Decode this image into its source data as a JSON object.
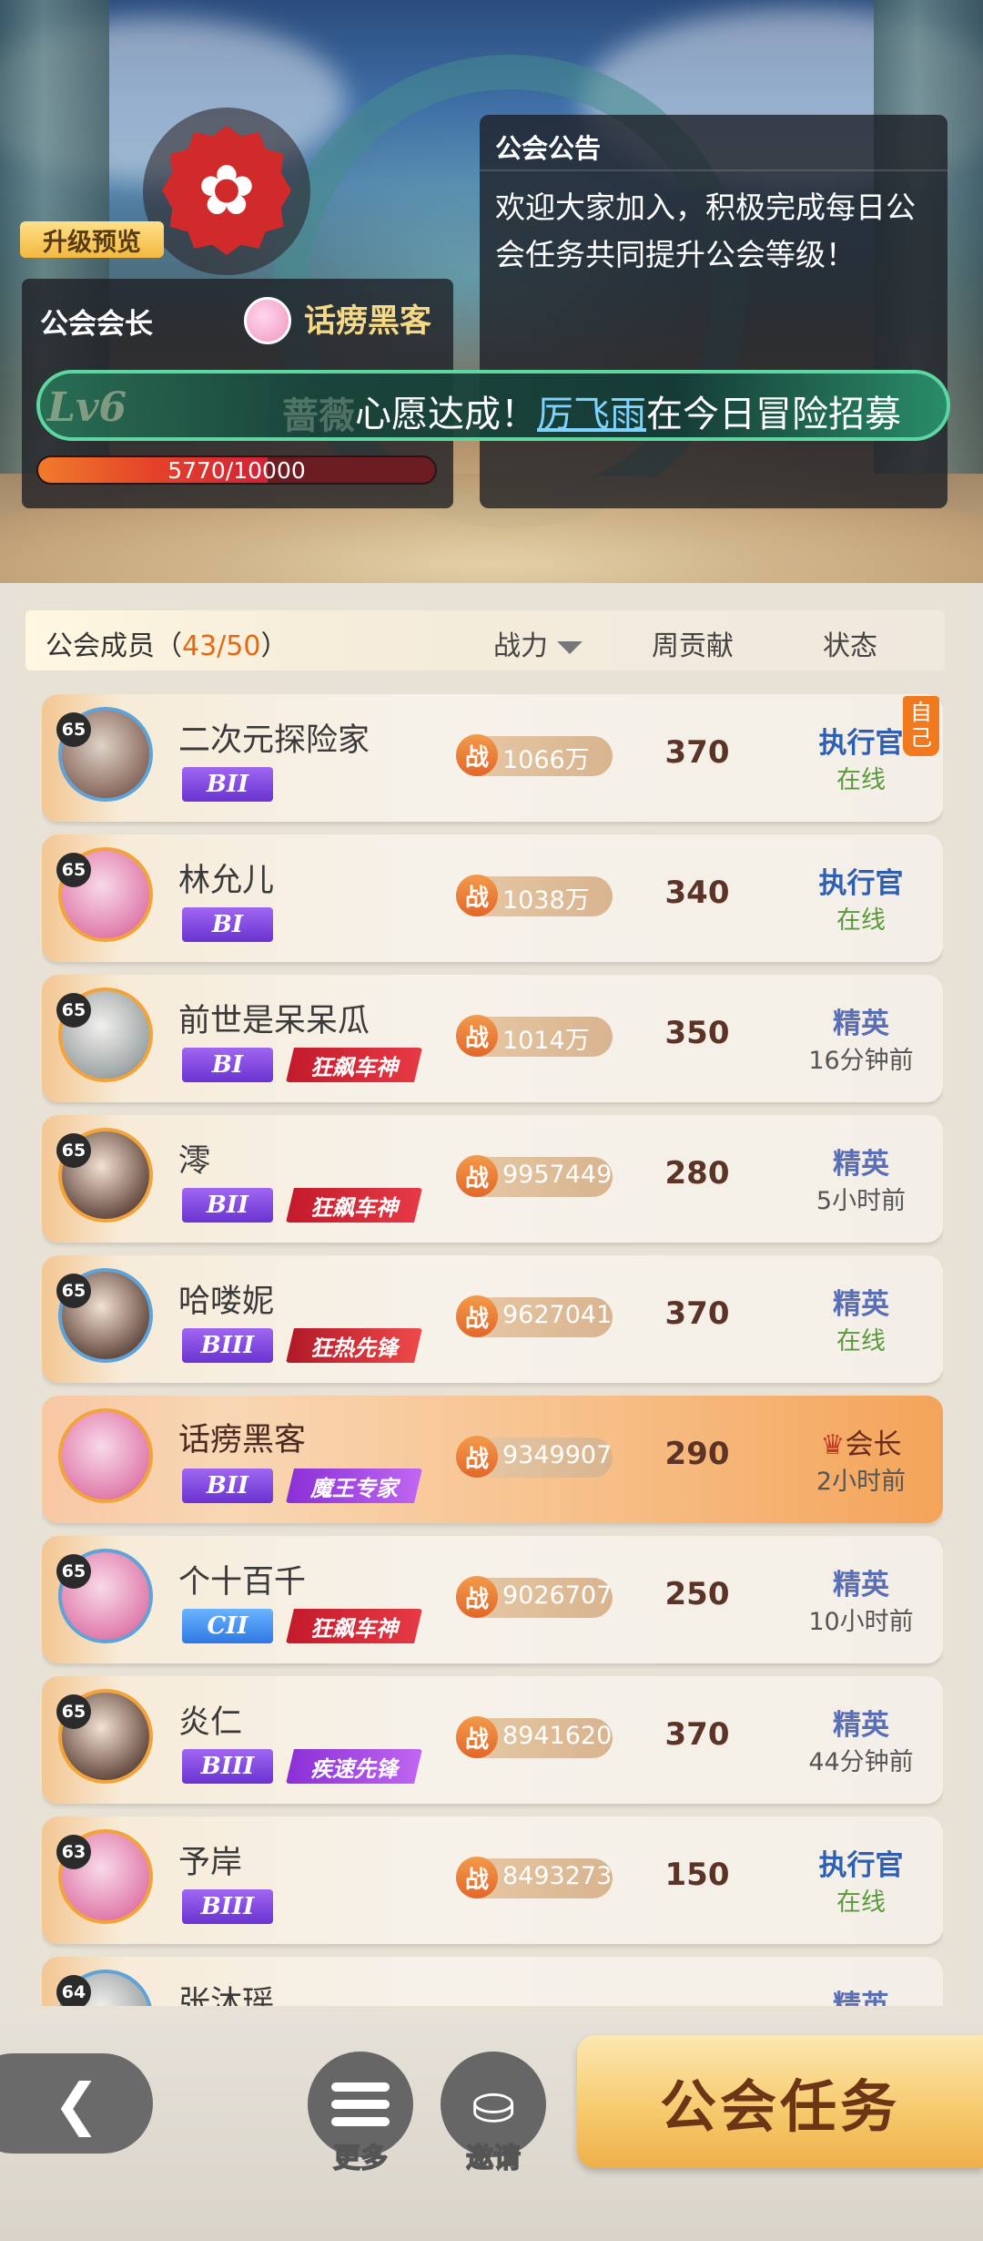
{
  "header": {
    "upgrade_preview": "升级预览",
    "leader_label": "公会会长",
    "leader_name": "话痨黑客",
    "notice_title": "公会公告",
    "notice_text": "欢迎大家加入，积极完成每日公会任务共同提升公会等级！",
    "level": "Lv6",
    "guild_name": "蔷薇",
    "ticker_prefix": "心愿达成！",
    "ticker_name": "厉飞雨",
    "ticker_suffix": "在今日冒险招募",
    "exp_text": "5770/10000",
    "exp_fraction": 0.577
  },
  "list_header": {
    "members_label": "公会成员",
    "members_paren_open": "（",
    "members_count": "43/50",
    "members_paren_close": "）",
    "power_label": "战力",
    "weekly_label": "周贡献",
    "status_label": "状态"
  },
  "members": [
    {
      "level": "65",
      "name": "二次元探险家",
      "rank": "BII",
      "title": "",
      "power": "1066万",
      "weekly": "370",
      "role": "执行官",
      "status": "在线",
      "self_tag": "自己"
    },
    {
      "level": "65",
      "name": "林允儿",
      "rank": "BI",
      "title": "",
      "power": "1038万",
      "weekly": "340",
      "role": "执行官",
      "status": "在线"
    },
    {
      "level": "65",
      "name": "前世是呆呆瓜",
      "rank": "BI",
      "title": "狂飙车神",
      "power": "1014万",
      "weekly": "350",
      "role": "精英",
      "status": "16分钟前"
    },
    {
      "level": "65",
      "name": "澪",
      "rank": "BII",
      "title": "狂飙车神",
      "power": "9957449",
      "weekly": "280",
      "role": "精英",
      "status": "5小时前"
    },
    {
      "level": "65",
      "name": "哈喽妮",
      "rank": "BIII",
      "title": "狂热先锋",
      "power": "9627041",
      "weekly": "370",
      "role": "精英",
      "status": "在线"
    },
    {
      "level": "",
      "name": "话痨黑客",
      "rank": "BII",
      "title": "魔王专家",
      "power": "9349907",
      "weekly": "290",
      "role": "会长",
      "status": "2小时前"
    },
    {
      "level": "65",
      "name": "个十百千",
      "rank": "CII",
      "title": "狂飙车神",
      "power": "9026707",
      "weekly": "250",
      "role": "精英",
      "status": "10小时前"
    },
    {
      "level": "65",
      "name": "炎仁",
      "rank": "BIII",
      "title": "疾速先锋",
      "power": "8941620",
      "weekly": "370",
      "role": "精英",
      "status": "44分钟前"
    },
    {
      "level": "63",
      "name": "予岸",
      "rank": "BIII",
      "title": "",
      "power": "8493273",
      "weekly": "150",
      "role": "执行官",
      "status": "在线"
    },
    {
      "level": "64",
      "name": "张沐瑶",
      "rank": "",
      "title": "",
      "power": "",
      "weekly": "",
      "role": "精英",
      "status": ""
    }
  ],
  "power_icon": "战",
  "bottom": {
    "back_icon": "chevron-left-icon",
    "more_label": "更多",
    "invite_label": "邀请",
    "task_label": "公会任务"
  }
}
